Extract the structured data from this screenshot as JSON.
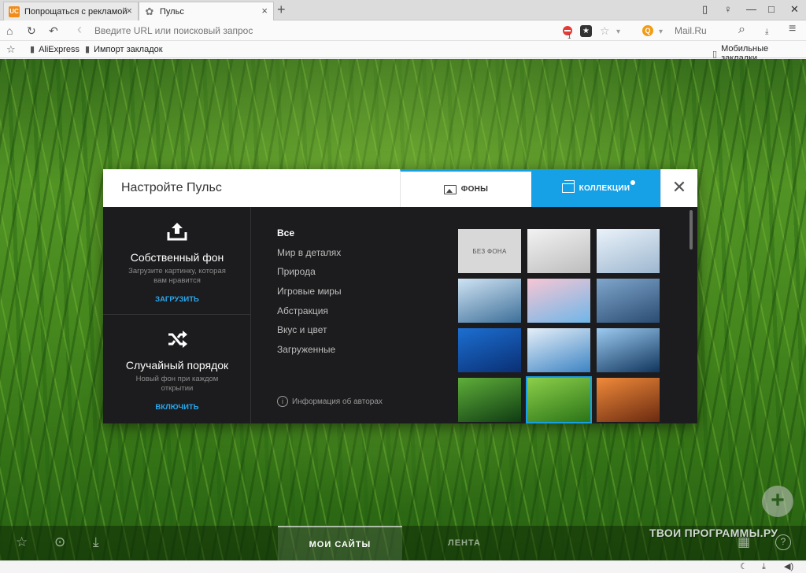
{
  "tabs": [
    {
      "label": "Попрощаться с рекламой",
      "icon": "uc-icon",
      "icon_text": "UC"
    },
    {
      "label": "Пульс",
      "icon": "gear-icon",
      "icon_text": "✿"
    }
  ],
  "tab_close_symbol": "×",
  "new_tab_symbol": "+",
  "window_controls": {
    "pin": "▯",
    "shirt": "♀",
    "minimize": "—",
    "maximize": "□",
    "close": "✕"
  },
  "navbar": {
    "home": "⌂",
    "reload": "↻",
    "undo": "↶",
    "back": "‹",
    "url_placeholder": "Введите URL или поисковый запрос",
    "adblock_count": "1",
    "star_box": "★",
    "bookmark_star": "☆",
    "dropdown": "▾",
    "search_engine_icon": "Q",
    "search_engine": "Mail.Ru",
    "search_icon": "⌕",
    "menu": "≡"
  },
  "bookmarks": {
    "star": "☆",
    "items": [
      {
        "label": "AliExpress",
        "icon": "page-icon"
      },
      {
        "label": "Импорт закладок",
        "icon": "folder-icon"
      }
    ],
    "mobile": "Мобильные закладки"
  },
  "modal": {
    "title": "Настройте Пульс",
    "tabs": [
      {
        "label": "ФОНЫ",
        "active": false
      },
      {
        "label": "КОЛЛЕКЦИИ",
        "active": true
      }
    ],
    "close": "✕",
    "own_bg": {
      "icon": "upload-icon",
      "title": "Собственный фон",
      "desc": "Загрузите картинку, которая вам нравится",
      "link": "ЗАГРУЗИТЬ"
    },
    "random": {
      "icon": "shuffle-icon",
      "title": "Случайный порядок",
      "desc": "Новый фон при каждом открытии",
      "link": "ВКЛЮЧИТЬ"
    },
    "categories": [
      "Все",
      "Мир в деталях",
      "Природа",
      "Игровые миры",
      "Абстракция",
      "Вкус и цвет",
      "Загруженные"
    ],
    "active_category": "Все",
    "authors_link": "Информация об авторах",
    "no_bg_label": "БЕЗ ФОНА",
    "thumbnails": [
      {
        "name": "no-background",
        "colors": [
          "#d8d8d8",
          "#d8d8d8"
        ]
      },
      {
        "name": "white-waves",
        "colors": [
          "#f2f2f2",
          "#bdbdbd"
        ]
      },
      {
        "name": "winter-branch",
        "colors": [
          "#eaf2fa",
          "#9db7cf"
        ]
      },
      {
        "name": "snow-mountain",
        "colors": [
          "#cfe3f3",
          "#3d6f99"
        ]
      },
      {
        "name": "cherry-blossom",
        "colors": [
          "#f7c6d4",
          "#6fb6e8"
        ]
      },
      {
        "name": "blue-petals",
        "colors": [
          "#7fa6cc",
          "#2b4c73"
        ]
      },
      {
        "name": "blue-layers",
        "colors": [
          "#1c6fd1",
          "#0a2f74"
        ]
      },
      {
        "name": "snowy-peaks",
        "colors": [
          "#e6eff8",
          "#3c84c4"
        ]
      },
      {
        "name": "ice-cave",
        "colors": [
          "#9ccaf0",
          "#10355d"
        ]
      },
      {
        "name": "green-leaf",
        "colors": [
          "#5fae3a",
          "#0f3c12"
        ]
      },
      {
        "name": "grass",
        "colors": [
          "#8ccf4a",
          "#2b7417"
        ]
      },
      {
        "name": "orange-sunset",
        "colors": [
          "#f08a3a",
          "#6a2a10"
        ]
      }
    ],
    "selected_thumbnail": "grass"
  },
  "pagebar": {
    "icons": [
      "☆",
      "⊙",
      "⤓"
    ],
    "tabs": [
      {
        "label": "МОИ САЙТЫ",
        "active": true
      },
      {
        "label": "ЛЕНТА",
        "active": false
      }
    ],
    "image_icon": "▦",
    "help_icon": "?",
    "add": "+"
  },
  "watermark": "ТВОИ ПРОГРАММЫ.РУ",
  "statusbar": {
    "night": "☾",
    "download": "⤓",
    "volume": "◀)"
  },
  "colors": {
    "accent": "#16a0e6",
    "modal_dark": "#1c1c1e",
    "uc_orange": "#f18c1a"
  }
}
